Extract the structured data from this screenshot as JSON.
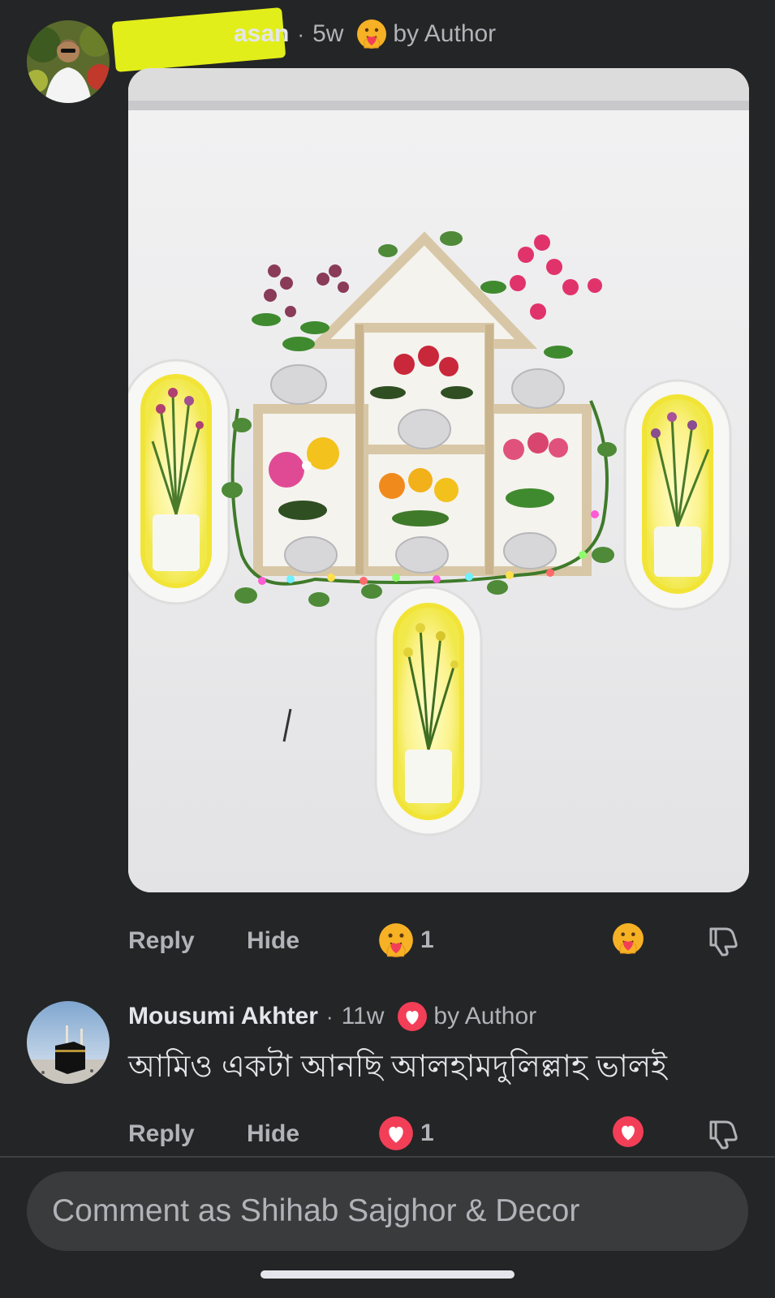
{
  "comments": [
    {
      "author_visible": "asan",
      "time": "5w",
      "author_reaction": {
        "icon": "care-emoji-icon",
        "label": "by Author"
      },
      "attachment": "photo of wooden house-shaped wall shelf with flower pots and lit oval lamps",
      "actions": {
        "reply": "Reply",
        "hide": "Hide",
        "reaction_count": "1",
        "reaction_icon": "care-emoji-icon"
      }
    },
    {
      "author": "Mousumi Akhter",
      "time": "11w",
      "author_reaction": {
        "icon": "love-heart-icon",
        "label": "by Author"
      },
      "text": "আমিও একটা আনছি আলহামদুলিল্লাহ ভালই",
      "actions": {
        "reply": "Reply",
        "hide": "Hide",
        "reaction_count": "1",
        "reaction_icon": "love-heart-icon"
      }
    }
  ],
  "composer": {
    "placeholder": "Comment as Shihab Sajghor & Decor"
  },
  "colors": {
    "background": "#242526",
    "secondary_text": "#b0b3b8",
    "primary_text": "#e4e6eb",
    "input_bg": "#3a3b3c",
    "love_red": "#f33e58",
    "care_yellow": "#f7b125",
    "redaction_highlight": "#e8f51a"
  }
}
